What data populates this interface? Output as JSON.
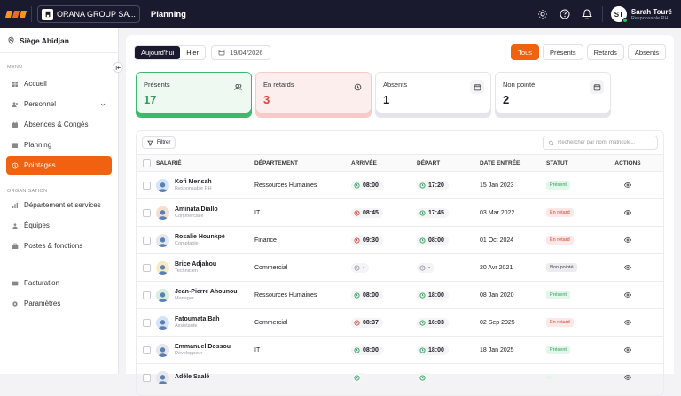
{
  "topbar": {
    "company": "ORANA GROUP SA...",
    "title": "Planning",
    "user": {
      "initials": "ST",
      "name": "Sarah Touré",
      "role": "Responsable RH"
    }
  },
  "sidebar": {
    "site": "Siège Abidjan",
    "menu_label": "MENU",
    "org_label": "ORGANISATION",
    "items": [
      {
        "label": "Accueil",
        "icon": "grid-icon"
      },
      {
        "label": "Personnel",
        "icon": "users-icon"
      },
      {
        "label": "Absences & Congés",
        "icon": "calendar-icon"
      },
      {
        "label": "Planning",
        "icon": "planning-icon"
      },
      {
        "label": "Pointages",
        "icon": "clock-icon",
        "active": true
      }
    ],
    "org_items": [
      {
        "label": "Département et services",
        "icon": "chart-icon"
      },
      {
        "label": "Équipes",
        "icon": "team-icon"
      },
      {
        "label": "Postes & fonctions",
        "icon": "briefcase-icon"
      }
    ],
    "bottom_items": [
      {
        "label": "Facturation",
        "icon": "billing-icon"
      },
      {
        "label": "Paramètres",
        "icon": "gear-icon"
      }
    ]
  },
  "toolbar": {
    "today": "Aujourd'hui",
    "yesterday": "Hier",
    "date": "19/04/2026",
    "filters": [
      "Tous",
      "Présents",
      "Retards",
      "Absents"
    ]
  },
  "cards": [
    {
      "label": "Présents",
      "value": "17"
    },
    {
      "label": "En retards",
      "value": "3"
    },
    {
      "label": "Absents",
      "value": "1"
    },
    {
      "label": "Non pointé",
      "value": "2"
    }
  ],
  "table": {
    "filter_label": "Filtrer",
    "search_placeholder": "Rechercher par nom, matricule...",
    "headers": [
      "SALARIÉ",
      "DÉPARTEMENT",
      "ARRIVÉE",
      "DÉPART",
      "DATE ENTRÉE",
      "STATUT",
      "ACTIONS"
    ],
    "rows": [
      {
        "name": "Kofi Mensah",
        "role": "Responsable RH",
        "dept": "Ressources Humaines",
        "arrival": "08:00",
        "departure": "17:20",
        "date": "15 Jan 2023",
        "status": "Présent",
        "avatar_color": "#d6e4fb",
        "arr_icon": "green",
        "dep_icon": "green",
        "status_type": "present"
      },
      {
        "name": "Aminata Diallo",
        "role": "Commerciale",
        "dept": "IT",
        "arrival": "08:45",
        "departure": "17:45",
        "date": "03 Mar 2022",
        "status": "En retard",
        "avatar_color": "#f5ddd0",
        "arr_icon": "red",
        "dep_icon": "green",
        "status_type": "late"
      },
      {
        "name": "Rosalie Hounkpè",
        "role": "Comptable",
        "dept": "Finance",
        "arrival": "09:30",
        "departure": "08:00",
        "date": "01 Oct 2024",
        "status": "En retard",
        "avatar_color": "#e6e6eb",
        "arr_icon": "red",
        "dep_icon": "green",
        "status_type": "late"
      },
      {
        "name": "Brice Adjahou",
        "role": "Technicien",
        "dept": "Commercial",
        "arrival": "-",
        "departure": "-",
        "date": "20 Avr 2021",
        "status": "Non pointé",
        "avatar_color": "#f7ebc3",
        "arr_icon": "grey",
        "dep_icon": "grey",
        "status_type": "np"
      },
      {
        "name": "Jean-Pierre Ahounou",
        "role": "Manager",
        "dept": "Ressources Humaines",
        "arrival": "08:00",
        "departure": "18:00",
        "date": "08 Jan 2020",
        "status": "Présent",
        "avatar_color": "#d5efdc",
        "arr_icon": "green",
        "dep_icon": "green",
        "status_type": "present"
      },
      {
        "name": "Fatoumata Bah",
        "role": "Assistante",
        "dept": "Commercial",
        "arrival": "08:37",
        "departure": "16:03",
        "date": "02 Sep 2025",
        "status": "En retard",
        "avatar_color": "#d6e4fb",
        "arr_icon": "red",
        "dep_icon": "green",
        "status_type": "late"
      },
      {
        "name": "Emmanuel Dossou",
        "role": "Développeur",
        "dept": "IT",
        "arrival": "08:00",
        "departure": "18:00",
        "date": "18 Jan 2025",
        "status": "Présent",
        "avatar_color": "#e6e6eb",
        "arr_icon": "green",
        "dep_icon": "green",
        "status_type": "present"
      },
      {
        "name": "Adéle Saalé",
        "role": "",
        "dept": "",
        "arrival": "",
        "departure": "",
        "date": "",
        "status": "",
        "avatar_color": "#e6e6eb",
        "arr_icon": "green",
        "dep_icon": "green",
        "status_type": "present"
      }
    ]
  },
  "colors": {
    "accent": "#f0620f",
    "dark": "#1a1a2e",
    "green": "#2f9e5a",
    "red": "#d9433a"
  }
}
